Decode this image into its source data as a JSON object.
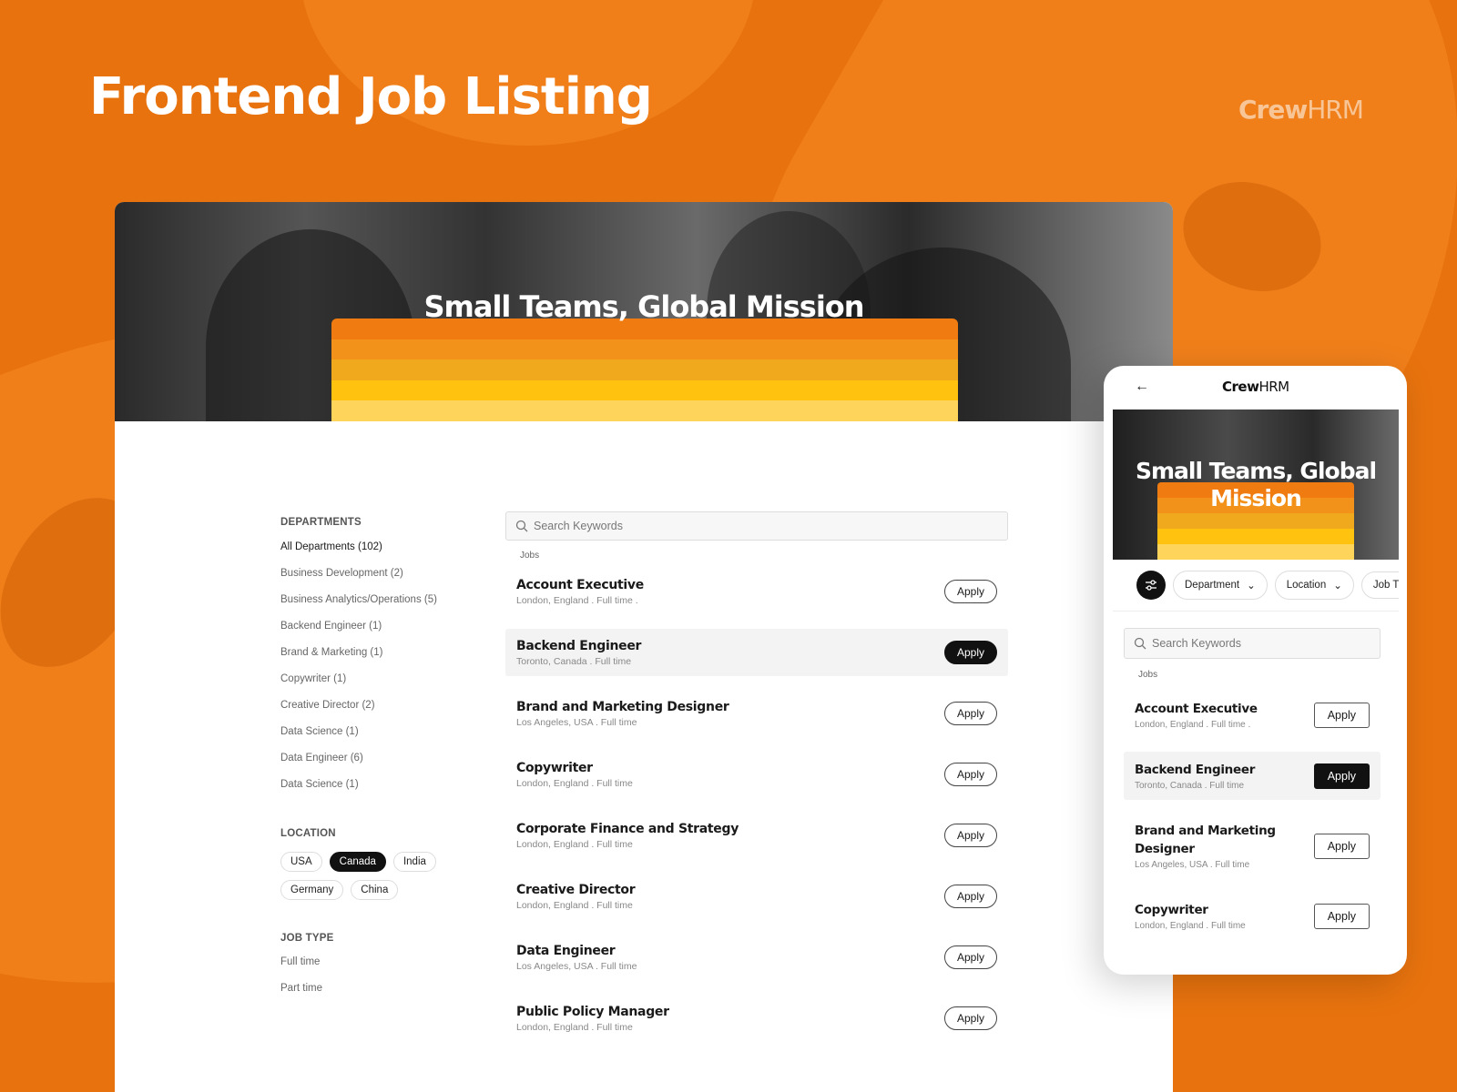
{
  "headline": "Frontend Job Listing",
  "brand": {
    "name": "Crew",
    "suffix": "HRM"
  },
  "colors": {
    "background": "#E8730E",
    "stripes": [
      "#F07B10",
      "#F2921A",
      "#F0A81C",
      "#FFC20E",
      "#FFD45A"
    ]
  },
  "desktop": {
    "hero_title": "Small Teams, Global Mission",
    "departments": {
      "heading": "DEPARTMENTS",
      "items": [
        "All Departments (102)",
        "Business Development (2)",
        "Business Analytics/Operations (5)",
        "Backend Engineer (1)",
        "Brand & Marketing (1)",
        "Copywriter (1)",
        "Creative Director (2)",
        "Data Science (1)",
        "Data Engineer (6)",
        "Data Science (1)"
      ]
    },
    "location": {
      "heading": "LOCATION",
      "chips": [
        "USA",
        "Canada",
        "India",
        "Germany",
        "China"
      ],
      "selected": "Canada"
    },
    "job_type": {
      "heading": "JOB TYPE",
      "items": [
        "Full time",
        "Part time"
      ]
    },
    "search": {
      "placeholder": "Search Keywords"
    },
    "jobs_label": "Jobs",
    "jobs": [
      {
        "title": "Account Executive",
        "meta": "London, England . Full time .",
        "apply": "Apply"
      },
      {
        "title": "Backend Engineer",
        "meta": "Toronto, Canada . Full time",
        "apply": "Apply"
      },
      {
        "title": "Brand and Marketing Designer",
        "meta": "Los Angeles, USA . Full time",
        "apply": "Apply"
      },
      {
        "title": "Copywriter",
        "meta": "London, England . Full time",
        "apply": "Apply"
      },
      {
        "title": "Corporate Finance and Strategy",
        "meta": "London, England . Full time",
        "apply": "Apply"
      },
      {
        "title": "Creative Director",
        "meta": "London, England . Full time",
        "apply": "Apply"
      },
      {
        "title": "Data Engineer",
        "meta": "Los Angeles, USA . Full time",
        "apply": "Apply"
      },
      {
        "title": "Public Policy Manager",
        "meta": "London, England . Full time",
        "apply": "Apply"
      }
    ]
  },
  "mobile": {
    "back_icon": "arrow-left-icon",
    "hero_title": "Small Teams, Global Mission",
    "filters": [
      "Department",
      "Location",
      "Job Ty"
    ],
    "search": {
      "placeholder": "Search Keywords"
    },
    "jobs_label": "Jobs",
    "jobs": [
      {
        "title": "Account Executive",
        "meta": "London, England . Full time .",
        "apply": "Apply"
      },
      {
        "title": "Backend Engineer",
        "meta": "Toronto, Canada . Full time",
        "apply": "Apply"
      },
      {
        "title": "Brand and Marketing Designer",
        "meta": "Los Angeles, USA . Full time",
        "apply": "Apply"
      },
      {
        "title": "Copywriter",
        "meta": "London, England . Full time",
        "apply": "Apply"
      }
    ]
  }
}
